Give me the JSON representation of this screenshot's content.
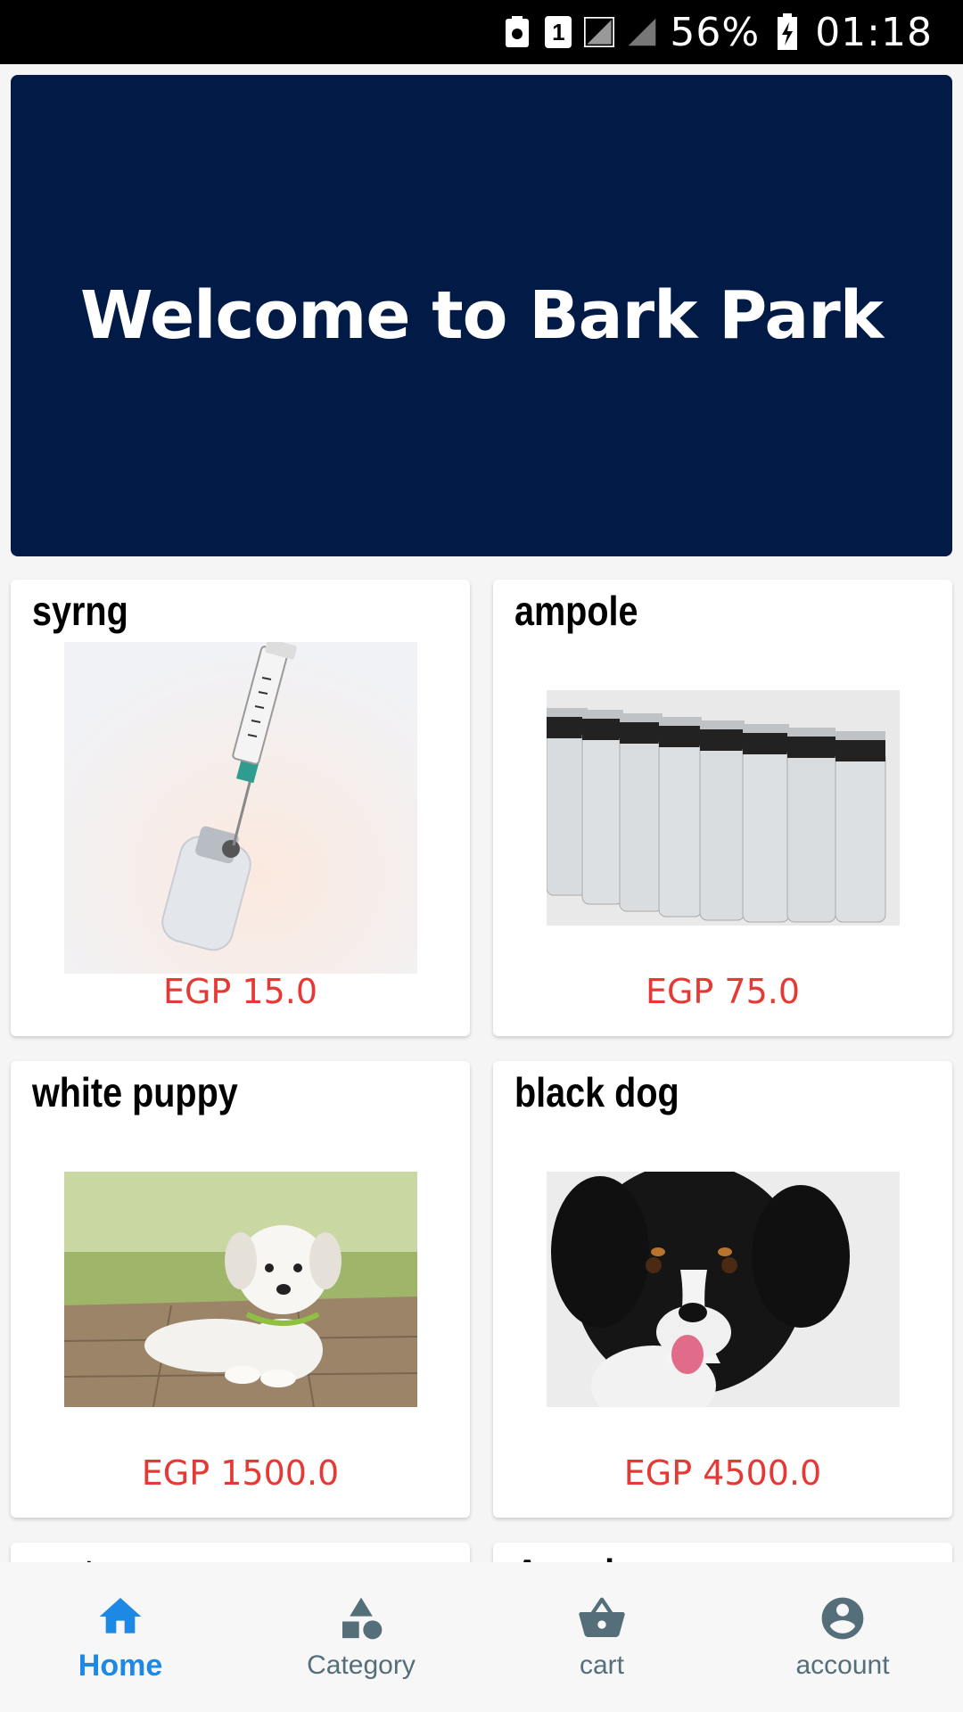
{
  "status_bar": {
    "battery": "56%",
    "time": "01:18",
    "sim": "1"
  },
  "banner": {
    "title": "Welcome to Bark Park",
    "background": "#021b46"
  },
  "products": [
    {
      "name": "syrng",
      "price": "EGP 15.0",
      "image": "syringe-vial-photo"
    },
    {
      "name": "ampole",
      "price": "EGP 75.0",
      "image": "glass-vials-photo"
    },
    {
      "name": "white puppy",
      "price": "EGP 1500.0",
      "image": "white-puppy-photo"
    },
    {
      "name": "black dog",
      "price": "EGP 4500.0",
      "image": "black-dog-photo"
    },
    {
      "name": "mat",
      "price": "",
      "image": ""
    },
    {
      "name": "American",
      "price": "",
      "image": ""
    }
  ],
  "bottom_nav": {
    "items": [
      {
        "label": "Home",
        "icon": "home-icon",
        "active": true
      },
      {
        "label": "Category",
        "icon": "category-icon",
        "active": false
      },
      {
        "label": "cart",
        "icon": "cart-icon",
        "active": false
      },
      {
        "label": "account",
        "icon": "account-icon",
        "active": false
      }
    ],
    "active_color": "#1e88e5",
    "inactive_color": "#546e7a"
  },
  "price_color": "#e53935"
}
